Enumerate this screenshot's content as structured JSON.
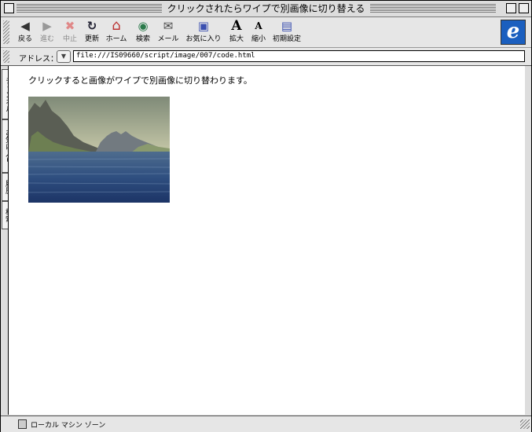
{
  "window": {
    "title": "クリックされたらワイプで別画像に切り替える"
  },
  "toolbar": {
    "buttons": [
      {
        "label": "戻る",
        "icon": "back-arrow-icon",
        "glyph": "◀"
      },
      {
        "label": "進む",
        "icon": "forward-arrow-icon",
        "glyph": "▶"
      },
      {
        "label": "中止",
        "icon": "stop-icon",
        "glyph": "✖"
      },
      {
        "label": "更新",
        "icon": "refresh-icon",
        "glyph": "↻"
      },
      {
        "label": "ホーム",
        "icon": "home-icon",
        "glyph": "⌂"
      },
      {
        "label": "検索",
        "icon": "search-icon",
        "glyph": "◉"
      },
      {
        "label": "メール",
        "icon": "mail-icon",
        "glyph": "✉"
      },
      {
        "label": "お気に入り",
        "icon": "favorites-icon",
        "glyph": "▣"
      },
      {
        "label": "拡大",
        "icon": "enlarge-font-icon",
        "glyph": "A"
      },
      {
        "label": "縮小",
        "icon": "shrink-font-icon",
        "glyph": "A"
      },
      {
        "label": "初期設定",
        "icon": "preferences-icon",
        "glyph": "▤"
      }
    ],
    "logo": "e"
  },
  "address": {
    "label": "アドレス：",
    "url": "file:///IS09660/script/image/007/code.html"
  },
  "sidetabs": [
    "チャンネル",
    "お気に入り",
    "履歴",
    "検索"
  ],
  "content": {
    "message": "クリックすると画像がワイプで別画像に切り替わります。"
  },
  "status": {
    "text": "ローカル マシン ゾーン"
  },
  "colors": {
    "ie_blue": "#1b5fbf",
    "sea": "#2a4a7a",
    "sky": "#9aa48c"
  }
}
